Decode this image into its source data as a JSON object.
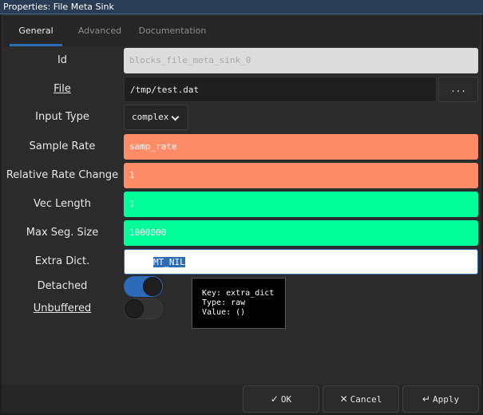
{
  "window": {
    "title": "Properties: File Meta Sink"
  },
  "tabs": [
    {
      "label": "General"
    },
    {
      "label": "Advanced"
    },
    {
      "label": "Documentation"
    }
  ],
  "fields": {
    "id": {
      "label": "Id",
      "value": "blocks_file_meta_sink_0"
    },
    "file": {
      "label": "File",
      "value": "/tmp/test.dat",
      "browse_label": "..."
    },
    "input_type": {
      "label": "Input Type",
      "value": "complex"
    },
    "sample_rate": {
      "label": "Sample Rate",
      "value": "samp_rate"
    },
    "rel_rate": {
      "label": "Relative Rate Change",
      "value": "1"
    },
    "vec_length": {
      "label": "Vec Length",
      "value": "1"
    },
    "max_seg": {
      "label": "Max Seg. Size",
      "value": "1000000"
    },
    "extra_dict": {
      "label": "Extra Dict.",
      "value": "MT_NIL"
    },
    "detached": {
      "label": "Detached",
      "on": true
    },
    "unbuffered": {
      "label": "Unbuffered",
      "on": false
    }
  },
  "tooltip": {
    "line1": "Key: extra_dict",
    "line2": "Type: raw",
    "line3": "Value: ()"
  },
  "buttons": {
    "ok": "OK",
    "cancel": "Cancel",
    "apply": "Apply"
  },
  "colors": {
    "accent": "#2b6cb5",
    "complex_float_field": "#ff8c69",
    "int_field": "#00ff99"
  }
}
